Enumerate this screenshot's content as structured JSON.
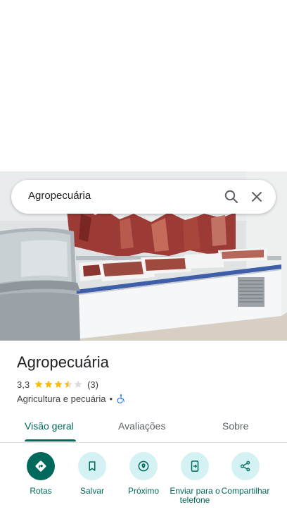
{
  "search": {
    "query": "Agropecuária"
  },
  "place": {
    "name": "Agropecuária",
    "rating": "3,3",
    "stars_filled": 3.5,
    "stars_total": 5,
    "review_count": "(3)",
    "category": "Agricultura e pecuária",
    "separator": "•"
  },
  "tabs": [
    {
      "label": "Visão geral",
      "active": true
    },
    {
      "label": "Avaliações",
      "active": false
    },
    {
      "label": "Sobre",
      "active": false
    }
  ],
  "actions": [
    {
      "label": "Rotas",
      "icon": "directions-icon"
    },
    {
      "label": "Salvar",
      "icon": "bookmark-icon"
    },
    {
      "label": "Próximo",
      "icon": "nearby-icon"
    },
    {
      "label": "Enviar para o telefone",
      "icon": "send-to-phone-icon"
    },
    {
      "label": "Compartilhar",
      "icon": "share-icon"
    }
  ],
  "colors": {
    "accent": "#00695c",
    "accent_light": "#d4f1f4",
    "star": "#fbbc04",
    "star_empty": "#dadce0"
  }
}
